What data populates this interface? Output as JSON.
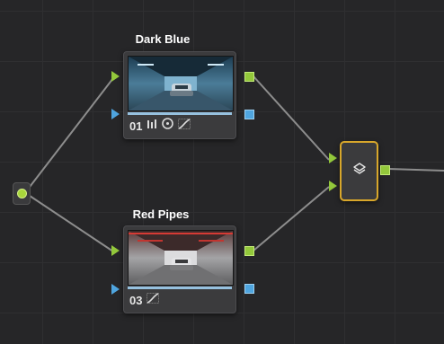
{
  "colors": {
    "background": "#262628",
    "wire": "#8d8d8d",
    "input_port": "#93c83b",
    "key_port": "#4fa5df",
    "selected_outline": "#d8a72b"
  },
  "nodes": [
    {
      "title": "Dark Blue",
      "number": "01",
      "tools": [
        "color-bars-icon",
        "circle-window-icon",
        "curves-icon"
      ]
    },
    {
      "title": "Red Pipes",
      "number": "03",
      "tools": [
        "curves-icon"
      ]
    }
  ],
  "mixer": {
    "icon": "layers-icon"
  }
}
